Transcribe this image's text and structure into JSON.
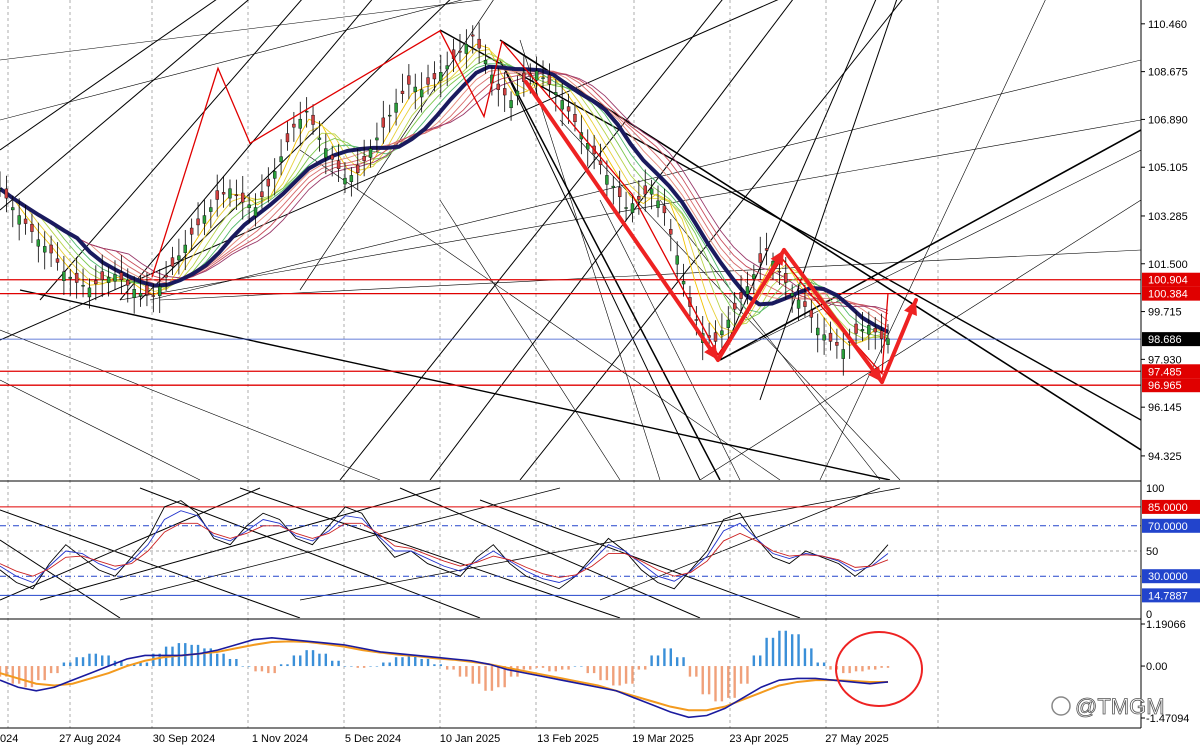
{
  "watermark": "@TMGM",
  "chart_data": [
    {
      "type": "candlestick",
      "panel": "price",
      "ylim": [
        93.5,
        111.2
      ],
      "y_ticks": [
        "110.460",
        "108.675",
        "106.890",
        "105.105",
        "103.285",
        "101.500",
        "99.715",
        "97.930",
        "96.145",
        "94.325"
      ],
      "y_tick_values": [
        110.46,
        108.675,
        106.89,
        105.105,
        103.285,
        101.5,
        99.715,
        97.93,
        96.145,
        94.325
      ],
      "price_tags": [
        {
          "label": "100.904",
          "value": 100.904,
          "color": "#e00000"
        },
        {
          "label": "100.384",
          "value": 100.384,
          "color": "#e00000"
        },
        {
          "label": "98.686",
          "value": 98.686,
          "color": "#000000"
        },
        {
          "label": "97.485",
          "value": 97.485,
          "color": "#e00000"
        },
        {
          "label": "96.965",
          "value": 96.965,
          "color": "#e00000"
        }
      ],
      "horizontal_lines": [
        {
          "value": 100.904,
          "color": "#e00000"
        },
        {
          "value": 100.384,
          "color": "#e00000"
        },
        {
          "value": 98.686,
          "color": "#3355cc"
        },
        {
          "value": 97.485,
          "color": "#e00000"
        },
        {
          "value": 96.965,
          "color": "#e00000"
        }
      ],
      "close_series": [
        104.3,
        103.6,
        103.0,
        102.4,
        101.9,
        101.2,
        100.8,
        100.6,
        100.9,
        101.1,
        100.7,
        100.4,
        100.3,
        101.0,
        101.8,
        102.6,
        103.3,
        103.9,
        104.3,
        103.8,
        103.6,
        104.4,
        105.5,
        106.6,
        107.2,
        106.2,
        105.4,
        104.7,
        104.9,
        105.8,
        106.6,
        107.5,
        108.2,
        108.0,
        108.4,
        108.9,
        109.4,
        110.0,
        109.1,
        108.0,
        107.6,
        108.3,
        108.7,
        108.2,
        107.6,
        106.8,
        106.0,
        105.2,
        104.4,
        103.6,
        103.9,
        104.3,
        103.4,
        101.8,
        99.9,
        98.9,
        98.6,
        99.4,
        100.2,
        101.1,
        102.0,
        101.2,
        100.4,
        99.9,
        99.1,
        98.6,
        98.3,
        98.9,
        99.2,
        98.7
      ],
      "zigzag": [
        101.0,
        108.8,
        106.0,
        107.2,
        110.2,
        107.0,
        109.8,
        104.1,
        98.1,
        101.7,
        100.3,
        97.4,
        100.4
      ]
    },
    {
      "type": "line",
      "panel": "stochastic",
      "ylim": [
        0,
        100
      ],
      "y_ticks": [
        "100",
        "50",
        "0"
      ],
      "levels": [
        {
          "label": "85.0000",
          "value": 85,
          "color": "#e00000"
        },
        {
          "label": "70.0000",
          "value": 70,
          "color": "#2244cc"
        },
        {
          "label": "30.0000",
          "value": 30,
          "color": "#2244cc"
        },
        {
          "label": "14.7887",
          "value": 14.7887,
          "color": "#2244cc"
        }
      ],
      "series": [
        {
          "color": "#000000",
          "values": [
            35,
            25,
            20,
            40,
            55,
            45,
            35,
            30,
            45,
            60,
            85,
            90,
            80,
            60,
            55,
            70,
            80,
            75,
            60,
            55,
            70,
            85,
            80,
            60,
            45,
            50,
            40,
            35,
            30,
            45,
            55,
            40,
            30,
            25,
            20,
            30,
            45,
            60,
            50,
            35,
            25,
            20,
            35,
            50,
            75,
            80,
            60,
            45,
            40,
            50,
            45,
            40,
            30,
            40,
            55
          ]
        },
        {
          "color": "#2233cc",
          "values": [
            38,
            30,
            25,
            38,
            50,
            48,
            40,
            35,
            42,
            55,
            75,
            82,
            78,
            62,
            58,
            66,
            75,
            72,
            62,
            58,
            66,
            78,
            76,
            62,
            50,
            50,
            44,
            38,
            34,
            42,
            50,
            42,
            34,
            28,
            25,
            30,
            42,
            55,
            50,
            40,
            30,
            26,
            34,
            46,
            66,
            72,
            60,
            48,
            44,
            48,
            46,
            42,
            34,
            38,
            48
          ]
        },
        {
          "color": "#cc2222",
          "values": [
            40,
            34,
            30,
            36,
            45,
            46,
            42,
            38,
            40,
            50,
            65,
            72,
            72,
            64,
            60,
            64,
            70,
            70,
            64,
            60,
            64,
            72,
            72,
            64,
            54,
            52,
            47,
            42,
            38,
            41,
            46,
            43,
            37,
            32,
            29,
            31,
            38,
            48,
            48,
            42,
            35,
            30,
            33,
            42,
            58,
            64,
            58,
            50,
            46,
            47,
            46,
            43,
            37,
            38,
            43
          ]
        }
      ]
    },
    {
      "type": "bar",
      "panel": "macd",
      "ylim": [
        -1.47094,
        1.19066
      ],
      "y_ticks": [
        "1.19066",
        "0.00",
        "-1.47094"
      ],
      "y_tick_values": [
        1.19066,
        0.0,
        -1.47094
      ],
      "histogram": [
        -0.3,
        -0.5,
        -0.6,
        -0.4,
        -0.2,
        0.1,
        0.25,
        0.35,
        0.3,
        0.15,
        0.05,
        0.1,
        0.35,
        0.55,
        0.65,
        0.6,
        0.5,
        0.35,
        0.2,
        0.0,
        -0.15,
        -0.2,
        0.05,
        0.3,
        0.45,
        0.35,
        0.15,
        0.0,
        -0.05,
        0.0,
        0.1,
        0.25,
        0.3,
        0.2,
        0.05,
        -0.1,
        -0.3,
        -0.5,
        -0.7,
        -0.6,
        -0.3,
        -0.1,
        -0.05,
        -0.15,
        -0.1,
        0.0,
        -0.2,
        -0.4,
        -0.55,
        -0.5,
        -0.1,
        0.3,
        0.5,
        0.25,
        -0.3,
        -0.8,
        -1.0,
        -0.9,
        -0.5,
        0.3,
        0.8,
        1.0,
        0.9,
        0.5,
        0.1,
        -0.1,
        -0.2,
        -0.15,
        -0.1,
        -0.05
      ],
      "macd_line": [
        -0.4,
        -0.6,
        -0.7,
        -0.6,
        -0.4,
        -0.2,
        0.0,
        0.2,
        0.3,
        0.3,
        0.3,
        0.35,
        0.45,
        0.6,
        0.75,
        0.8,
        0.75,
        0.7,
        0.65,
        0.6,
        0.5,
        0.4,
        0.35,
        0.3,
        0.25,
        0.2,
        0.15,
        0.05,
        -0.1,
        -0.2,
        -0.3,
        -0.4,
        -0.5,
        -0.6,
        -0.7,
        -0.9,
        -1.1,
        -1.3,
        -1.45,
        -1.4,
        -1.2,
        -0.9,
        -0.6,
        -0.4,
        -0.35,
        -0.35,
        -0.4,
        -0.45,
        -0.5,
        -0.45
      ],
      "signal_line": [
        -0.2,
        -0.35,
        -0.5,
        -0.55,
        -0.5,
        -0.35,
        -0.2,
        0.0,
        0.15,
        0.25,
        0.3,
        0.35,
        0.4,
        0.5,
        0.6,
        0.68,
        0.7,
        0.68,
        0.62,
        0.55,
        0.45,
        0.38,
        0.32,
        0.28,
        0.22,
        0.18,
        0.12,
        0.05,
        -0.05,
        -0.15,
        -0.25,
        -0.35,
        -0.45,
        -0.55,
        -0.7,
        -0.85,
        -1.0,
        -1.15,
        -1.25,
        -1.25,
        -1.15,
        -0.95,
        -0.75,
        -0.55,
        -0.45,
        -0.4,
        -0.4,
        -0.42,
        -0.45,
        -0.45
      ]
    }
  ],
  "x_axis": {
    "labels": [
      "024",
      "27 Aug 2024",
      "30 Sep 2024",
      "1 Nov 2024",
      "5 Dec 2024",
      "10 Jan 2025",
      "13 Feb 2025",
      "19 Mar 2025",
      "23 Apr 2025",
      "27 May 2025"
    ]
  },
  "colors": {
    "red_line": "#e00000",
    "blue_line": "#2244cc",
    "trend_arrow": "#ee2222",
    "ma_main": "#1a1a5e",
    "hist_pos": "#3a8fd8",
    "hist_neg": "#f0a07a",
    "signal": "#f39a1e"
  }
}
